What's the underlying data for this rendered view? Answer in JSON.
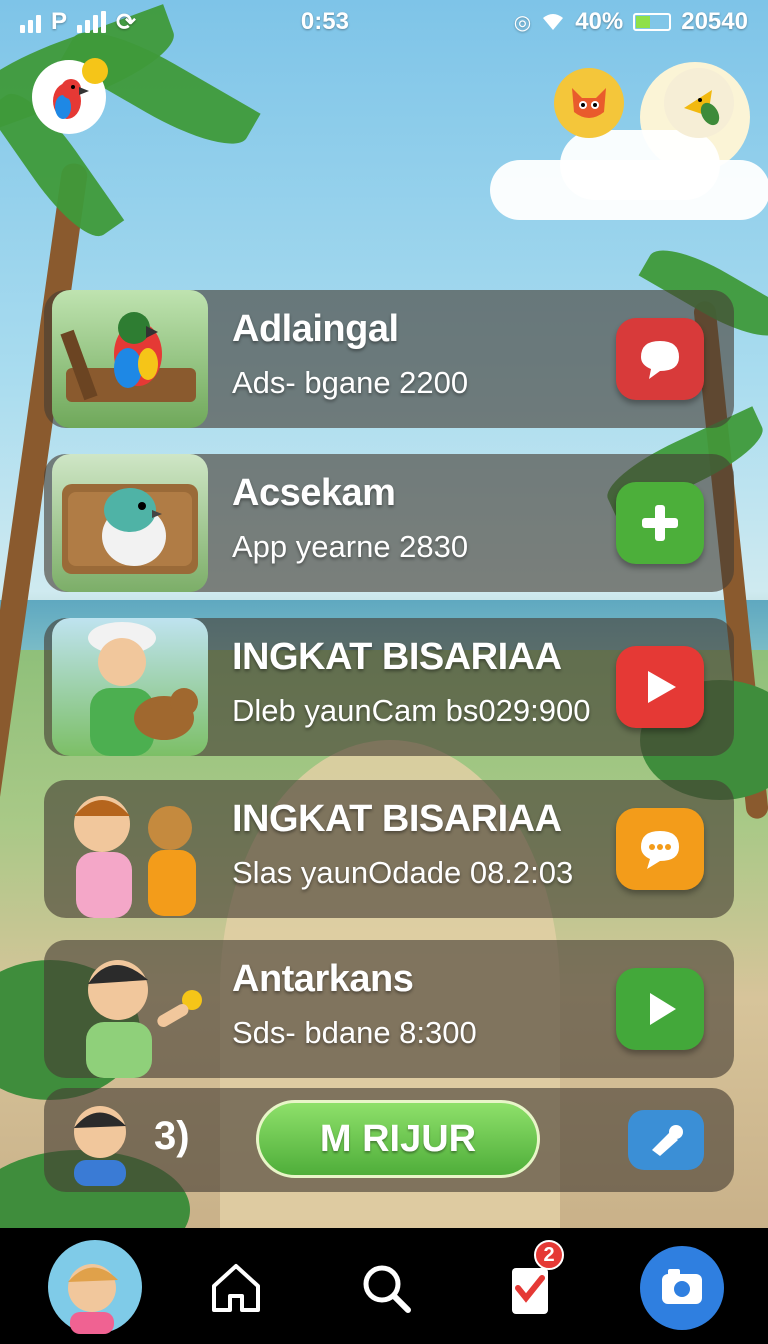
{
  "status": {
    "time": "0:53",
    "carrier": "P",
    "battery_percent": "40%",
    "extra": "20540",
    "battery_level": 0.4
  },
  "items": [
    {
      "title": "Adlaingal",
      "subtitle": "Ads- bgane 2200",
      "action_icon": "chat-bubble-icon",
      "action_color": "#d83a3a"
    },
    {
      "title": "Acsekam",
      "subtitle": "App yearne 2830",
      "action_icon": "plus-icon",
      "action_color": "#4caf3a"
    },
    {
      "title": "INGKAT BISARIAA",
      "subtitle": "Dleb yaunCam bs029:900",
      "action_icon": "play-icon",
      "action_color": "#e53935"
    },
    {
      "title": "INGKAT BISARIAA",
      "subtitle": "Slas yaunOdade 08.2:03",
      "action_icon": "speech-bubble-icon",
      "action_color": "#f39c1a"
    },
    {
      "title": "Antarkans",
      "subtitle": "Sds- bdane 8:300",
      "action_icon": "play-icon",
      "action_color": "#43a83a"
    }
  ],
  "bottom_bar": {
    "count_label": "3)",
    "main_button_label": "M RIJUR",
    "side_icon": "megaphone-icon"
  },
  "nav": {
    "items": [
      "profile-avatar",
      "home-icon",
      "search-icon",
      "checklist-icon",
      "camera-icon"
    ],
    "checklist_badge": "2"
  }
}
